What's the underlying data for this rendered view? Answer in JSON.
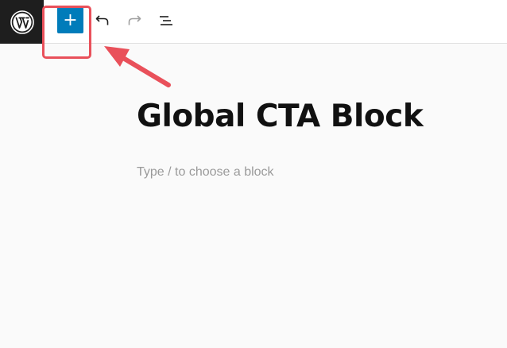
{
  "toolbar": {
    "logo_icon": "wordpress-logo-icon",
    "inserter_label": "+",
    "inserter_color": "#007cba",
    "undo_icon": "undo-icon",
    "redo_icon": "redo-icon",
    "outline_icon": "list-view-icon"
  },
  "annotation": {
    "highlight_color": "#e9505a"
  },
  "editor": {
    "post_title": "Global CTA Block",
    "block_placeholder": "Type / to choose a block"
  }
}
